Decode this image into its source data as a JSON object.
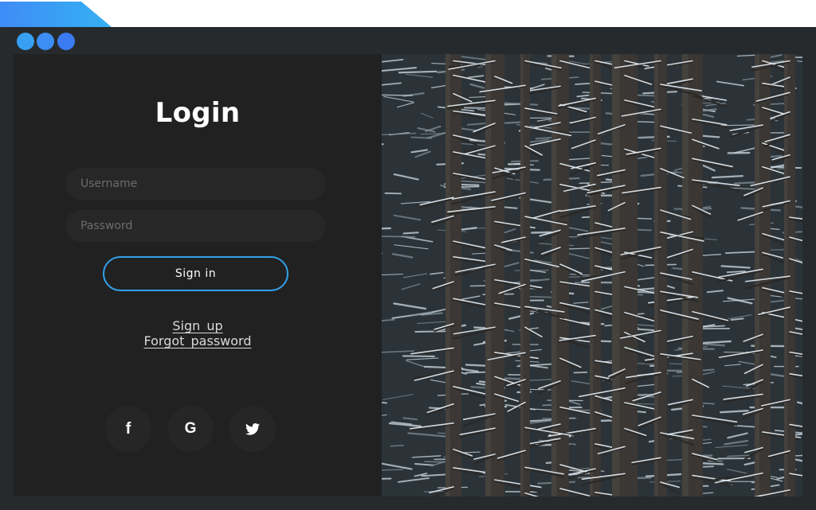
{
  "colors": {
    "accent": "#32a2ec",
    "window_bg": "#262a2c",
    "panel_bg": "#212121",
    "field_bg": "#272727",
    "social_bg": "#262626"
  },
  "window": {
    "controls": [
      "circle-blue",
      "circle-blue",
      "circle-blue"
    ]
  },
  "login": {
    "title": "Login",
    "username_placeholder": "Username",
    "password_placeholder": "Password",
    "signin_label": "Sign in",
    "signup_link": "Sign up",
    "forgot_link": "Forgot password"
  },
  "social": [
    {
      "icon": "facebook-icon",
      "glyph": "f"
    },
    {
      "icon": "google-icon",
      "glyph": "G"
    },
    {
      "icon": "twitter-icon",
      "glyph": "bird"
    }
  ],
  "photo": {
    "subject": "snow-covered forest"
  }
}
